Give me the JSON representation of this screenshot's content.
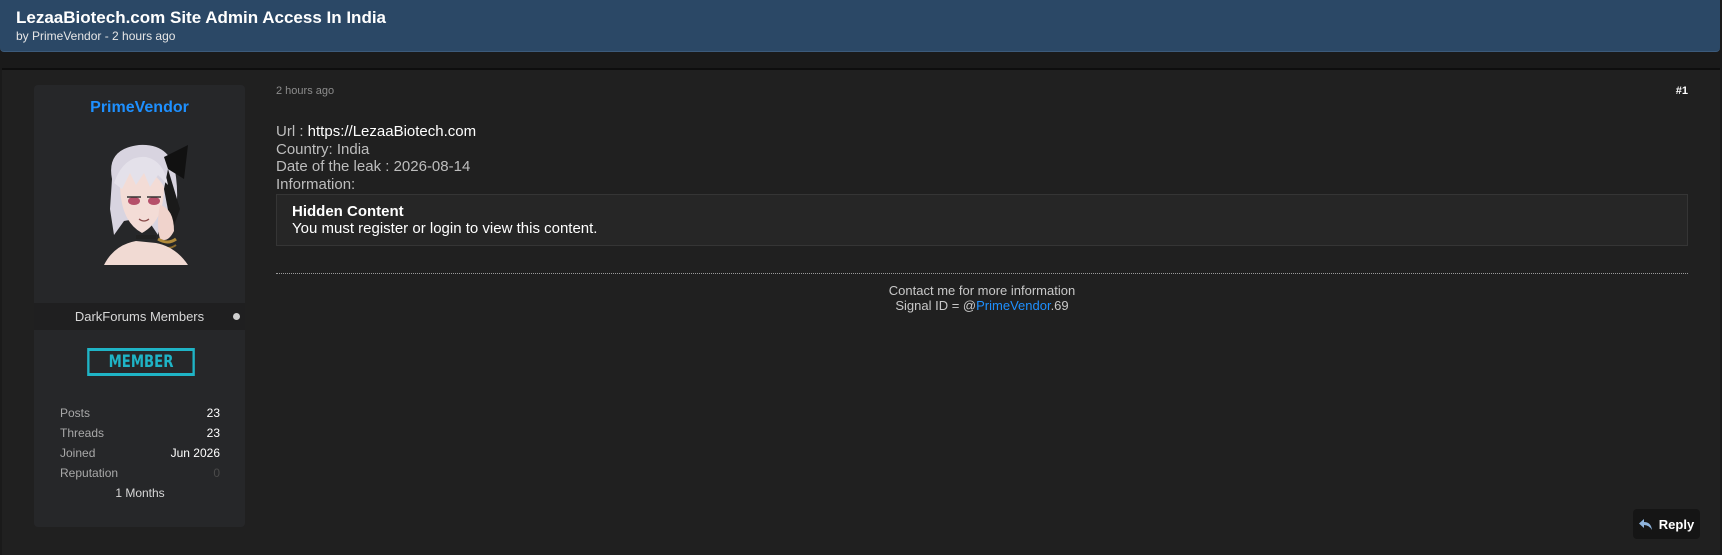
{
  "thread": {
    "title": "LezaaBiotech.com Site Admin Access In India",
    "byline": "by PrimeVendor - 2 hours ago"
  },
  "author": {
    "name": "PrimeVendor",
    "usergroup": "DarkForums Members",
    "rank": "MEMBER",
    "stats": [
      {
        "label": "Posts",
        "value": "23"
      },
      {
        "label": "Threads",
        "value": "23"
      },
      {
        "label": "Joined",
        "value": "Jun 2026"
      },
      {
        "label": "Reputation",
        "value": "0"
      }
    ],
    "tenure": "1 Months"
  },
  "post": {
    "date": "2 hours ago",
    "number": "#1",
    "url_label": "Url : ",
    "url_value": "https://LezaaBiotech.com",
    "country": "Country: India",
    "leak_date": "Date of the leak : 2026-08-14",
    "information": "Information:",
    "hidden_title": "Hidden Content",
    "hidden_msg_before": "You must ",
    "hidden_register": "register",
    "hidden_or": " or ",
    "hidden_login": "login",
    "hidden_msg_after": " to view this content."
  },
  "signature": {
    "line1": "Contact me for more information",
    "line2_prefix": "Signal ID = @",
    "line2_link": "PrimeVendor",
    "line2_suffix": ".69"
  },
  "actions": {
    "reply_label": "Reply"
  },
  "colors": {
    "header_bg": "#2b4866",
    "username": "#1e90ff",
    "rank_badge": "#1fb4c6"
  }
}
